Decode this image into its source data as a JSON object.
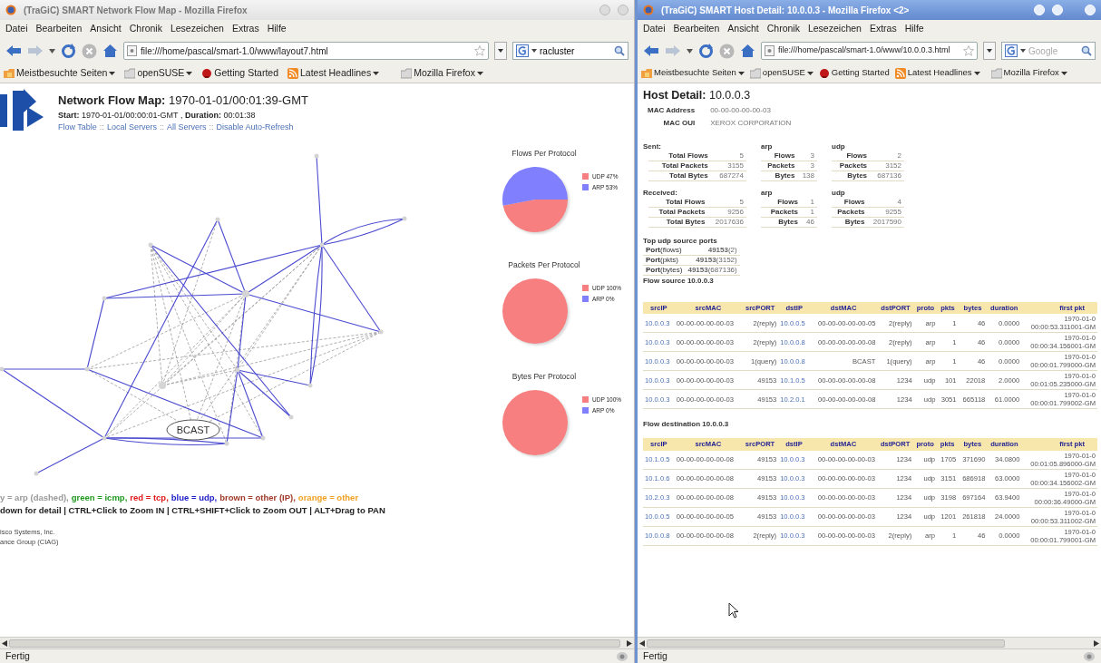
{
  "windows": [
    {
      "kind": "flow_map",
      "active": false,
      "title": "(TraGiC) SMART Network Flow Map - Mozilla Firefox",
      "menu": [
        "Datei",
        "Bearbeiten",
        "Ansicht",
        "Chronik",
        "Lesezeichen",
        "Extras",
        "Hilfe"
      ],
      "url": "file:///home/pascal/smart-1.0/www/layout7.html",
      "search": {
        "value": "racluster"
      },
      "bookmarks": [
        {
          "label": "Meistbesuchte Seiten",
          "menu": true
        },
        {
          "label": "openSUSE",
          "menu": true
        },
        {
          "label": "Getting Started",
          "menu": false
        },
        {
          "label": "Latest Headlines",
          "menu": true
        },
        {
          "label": "Mozilla Firefox",
          "menu": true
        }
      ],
      "status": "Fertig",
      "page": {
        "heading": "**Network Flow Map:** 1970-01-01/00:01:39-GMT",
        "subheading": "**Start:** 1970-01-01/00:00:01-GMT , **Duration:** 00:01:38",
        "links": [
          {
            "kind": "link",
            "text": "Flow Table"
          },
          {
            "kind": "separator",
            "text": "::"
          },
          {
            "kind": "link",
            "text": "Local Servers"
          },
          {
            "kind": "separator",
            "text": "::"
          },
          {
            "kind": "link",
            "text": "All Servers"
          },
          {
            "kind": "separator",
            "text": "::"
          },
          {
            "kind": "link",
            "text": "Disable Auto-Refresh"
          }
        ],
        "graph": {
          "broadcast_label": "BCAST"
        },
        "pies": [
          {
            "chart_data": {
              "type": "pie",
              "title": "Flows Per Protocol",
              "categories": [
                "UDP",
                "ARP"
              ],
              "values": [
                47,
                53
              ],
              "value_labels": [
                "47%",
                "53%"
              ],
              "legend": "right"
            }
          },
          {
            "chart_data": {
              "type": "pie",
              "title": "Packets Per Protocol",
              "categories": [
                "UDP",
                "ARP"
              ],
              "values": [
                100,
                0
              ],
              "value_labels": [
                "100%",
                "0%"
              ],
              "legend": "right"
            }
          },
          {
            "chart_data": {
              "type": "pie",
              "title": "Bytes Per Protocol",
              "categories": [
                "UDP",
                "ARP"
              ],
              "values": [
                100,
                0
              ],
              "value_labels": [
                "100%",
                "0%"
              ],
              "legend": "right"
            }
          }
        ],
        "legend": [
          {
            "text": "y = arp (dashed),",
            "color": "#9a9a9a"
          },
          {
            "text": "green = icmp,",
            "color": "#1f9a1f"
          },
          {
            "text": "red = tcp,",
            "color": "#e01818"
          },
          {
            "text": "blue = udp,",
            "color": "#2020c8"
          },
          {
            "text": "brown = other (IP),",
            "color": "#a03a2a"
          },
          {
            "text": "orange = other",
            "color": "#f0a020"
          }
        ],
        "instructions": "down for detail | CTRL+Click to Zoom IN | CTRL+SHIFT+Click to Zoom OUT | ALT+Drag to PAN",
        "footer": [
          "isco Systems, Inc.",
          "ance Group (CIAG)"
        ]
      }
    },
    {
      "kind": "host_detail",
      "active": true,
      "title": "(TraGiC) SMART Host Detail: 10.0.0.3 - Mozilla Firefox <2>",
      "menu": [
        "Datei",
        "Bearbeiten",
        "Ansicht",
        "Chronik",
        "Lesezeichen",
        "Extras",
        "Hilfe"
      ],
      "url": "file:///home/pascal/smart-1.0/www/10.0.0.3.html",
      "search": {
        "placeholder": "Google"
      },
      "bookmarks": [
        {
          "label": "Meistbesuchte Seiten",
          "menu": true
        },
        {
          "label": "openSUSE",
          "menu": true
        },
        {
          "label": "Getting Started",
          "menu": false
        },
        {
          "label": "Latest Headlines",
          "menu": true
        },
        {
          "label": "Mozilla Firefox",
          "menu": true
        }
      ],
      "status": "Fertig",
      "page": {
        "heading": "**Host Detail:** 10.0.0.3",
        "info": [
          {
            "label": "MAC Address",
            "value": "00-00-00-00-00-03"
          },
          {
            "label": "MAC OUI",
            "value": "XEROX CORPORATION"
          }
        ],
        "traffic": [
          {
            "groups": [
              {
                "heading": "Sent:",
                "rows": [
                  {
                    "label": "Total Flows",
                    "value": "5"
                  },
                  {
                    "label": "Total Packets",
                    "value": "3155"
                  },
                  {
                    "label": "Total Bytes",
                    "value": "687274"
                  }
                ]
              },
              {
                "heading": "arp",
                "rows": [
                  {
                    "label": "Flows",
                    "value": "3"
                  },
                  {
                    "label": "Packets",
                    "value": "3"
                  },
                  {
                    "label": "Bytes",
                    "value": "138"
                  }
                ]
              },
              {
                "heading": "udp",
                "rows": [
                  {
                    "label": "Flows",
                    "value": "2"
                  },
                  {
                    "label": "Packets",
                    "value": "3152"
                  },
                  {
                    "label": "Bytes",
                    "value": "687136"
                  }
                ]
              }
            ]
          },
          {
            "groups": [
              {
                "heading": "Received:",
                "rows": [
                  {
                    "label": "Total Flows",
                    "value": "5"
                  },
                  {
                    "label": "Total Packets",
                    "value": "9256"
                  },
                  {
                    "label": "Total Bytes",
                    "value": "2017636"
                  }
                ]
              },
              {
                "heading": "arp",
                "rows": [
                  {
                    "label": "Flows",
                    "value": "1"
                  },
                  {
                    "label": "Packets",
                    "value": "1"
                  },
                  {
                    "label": "Bytes",
                    "value": "46"
                  }
                ]
              },
              {
                "heading": "udp",
                "rows": [
                  {
                    "label": "Flows",
                    "value": "4"
                  },
                  {
                    "label": "Packets",
                    "value": "9255"
                  },
                  {
                    "label": "Bytes",
                    "value": "2017590"
                  }
                ]
              }
            ]
          }
        ],
        "ports": {
          "heading": "Top udp source ports",
          "rows": [
            {
              "label": "**Port**(flows)",
              "value": "**49153**(2)"
            },
            {
              "label": "**Port**(pkts)",
              "value": "**49153**(3152)"
            },
            {
              "label": "**Port**(bytes)",
              "value": "**49153**(687136)"
            }
          ]
        },
        "flow_tables": [
          {
            "heading": "Flow source 10.0.0.3",
            "columns": [
              {
                "label": "srcIP",
                "kind": "link"
              },
              {
                "label": "srcMAC",
                "kind": "label"
              },
              {
                "label": "srcPORT",
                "kind": "value"
              },
              {
                "label": "dstIP",
                "kind": "link"
              },
              {
                "label": "dstMAC",
                "kind": "value"
              },
              {
                "label": "dstPORT",
                "kind": "value"
              },
              {
                "label": "proto",
                "kind": "value"
              },
              {
                "label": "pkts",
                "kind": "value"
              },
              {
                "label": "bytes",
                "kind": "value"
              },
              {
                "label": "duration",
                "kind": "value"
              },
              {
                "label": "first pkt",
                "kind": "stamp"
              }
            ],
            "rows": [
              {
                "cells": [
                  "10.0.0.3",
                  "00-00-00-00-00-03",
                  "2(reply)",
                  "10.0.0.5",
                  "00-00-00-00-00-05",
                  "2(reply)",
                  "arp",
                  "1",
                  "46",
                  "0.0000"
                ],
                "first_pkt": [
                  "1970-01-0",
                  "00:00:53.311001-GM"
                ]
              },
              {
                "cells": [
                  "10.0.0.3",
                  "00-00-00-00-00-03",
                  "2(reply)",
                  "10.0.0.8",
                  "00-00-00-00-00-08",
                  "2(reply)",
                  "arp",
                  "1",
                  "46",
                  "0.0000"
                ],
                "first_pkt": [
                  "1970-01-0",
                  "00:00:34.156001-GM"
                ]
              },
              {
                "cells": [
                  "10.0.0.3",
                  "00-00-00-00-00-03",
                  "1(query)",
                  "10.0.0.8",
                  "BCAST",
                  "1(query)",
                  "arp",
                  "1",
                  "46",
                  "0.0000"
                ],
                "first_pkt": [
                  "1970-01-0",
                  "00:00:01.799000-GM"
                ]
              },
              {
                "cells": [
                  "10.0.0.3",
                  "00-00-00-00-00-03",
                  "49153",
                  "10.1.0.5",
                  "00-00-00-00-00-08",
                  "1234",
                  "udp",
                  "101",
                  "22018",
                  "2.0000"
                ],
                "first_pkt": [
                  "1970-01-0",
                  "00:01:05.235000-GM"
                ]
              },
              {
                "cells": [
                  "10.0.0.3",
                  "00-00-00-00-00-03",
                  "49153",
                  "10.2.0.1",
                  "00-00-00-00-00-08",
                  "1234",
                  "udp",
                  "3051",
                  "665118",
                  "61.0000"
                ],
                "first_pkt": [
                  "1970-01-0",
                  "00:00:01.799002-GM"
                ]
              }
            ]
          },
          {
            "heading": "Flow destination 10.0.0.3",
            "columns": [
              {
                "label": "srcIP",
                "kind": "link"
              },
              {
                "label": "srcMAC",
                "kind": "label"
              },
              {
                "label": "srcPORT",
                "kind": "value"
              },
              {
                "label": "dstIP",
                "kind": "link"
              },
              {
                "label": "dstMAC",
                "kind": "value"
              },
              {
                "label": "dstPORT",
                "kind": "value"
              },
              {
                "label": "proto",
                "kind": "value"
              },
              {
                "label": "pkts",
                "kind": "value"
              },
              {
                "label": "bytes",
                "kind": "value"
              },
              {
                "label": "duration",
                "kind": "value"
              },
              {
                "label": "first pkt",
                "kind": "stamp"
              }
            ],
            "rows": [
              {
                "cells": [
                  "10.1.0.5",
                  "00-00-00-00-00-08",
                  "49153",
                  "10.0.0.3",
                  "00-00-00-00-00-03",
                  "1234",
                  "udp",
                  "1705",
                  "371690",
                  "34.0800"
                ],
                "first_pkt": [
                  "1970-01-0",
                  "00:01:05.896000-GM"
                ]
              },
              {
                "cells": [
                  "10.1.0.6",
                  "00-00-00-00-00-08",
                  "49153",
                  "10.0.0.3",
                  "00-00-00-00-00-03",
                  "1234",
                  "udp",
                  "3151",
                  "686918",
                  "63.0000"
                ],
                "first_pkt": [
                  "1970-01-0",
                  "00:00:34.156002-GM"
                ]
              },
              {
                "cells": [
                  "10.2.0.3",
                  "00-00-00-00-00-08",
                  "49153",
                  "10.0.0.3",
                  "00-00-00-00-00-03",
                  "1234",
                  "udp",
                  "3198",
                  "697164",
                  "63.9400"
                ],
                "first_pkt": [
                  "1970-01-0",
                  "00:00:36.49000-GM"
                ]
              },
              {
                "cells": [
                  "10.0.0.5",
                  "00-00-00-00-00-05",
                  "49153",
                  "10.0.0.3",
                  "00-00-00-00-00-03",
                  "1234",
                  "udp",
                  "1201",
                  "261818",
                  "24.0000"
                ],
                "first_pkt": [
                  "1970-01-0",
                  "00:00:53.311002-GM"
                ]
              },
              {
                "cells": [
                  "10.0.0.8",
                  "00-00-00-00-00-08",
                  "2(reply)",
                  "10.0.0.3",
                  "00-00-00-00-00-03",
                  "2(reply)",
                  "arp",
                  "1",
                  "46",
                  "0.0000"
                ],
                "first_pkt": [
                  "1970-01-0",
                  "00:00:01.799001-GM"
                ]
              }
            ]
          }
        ]
      }
    }
  ]
}
